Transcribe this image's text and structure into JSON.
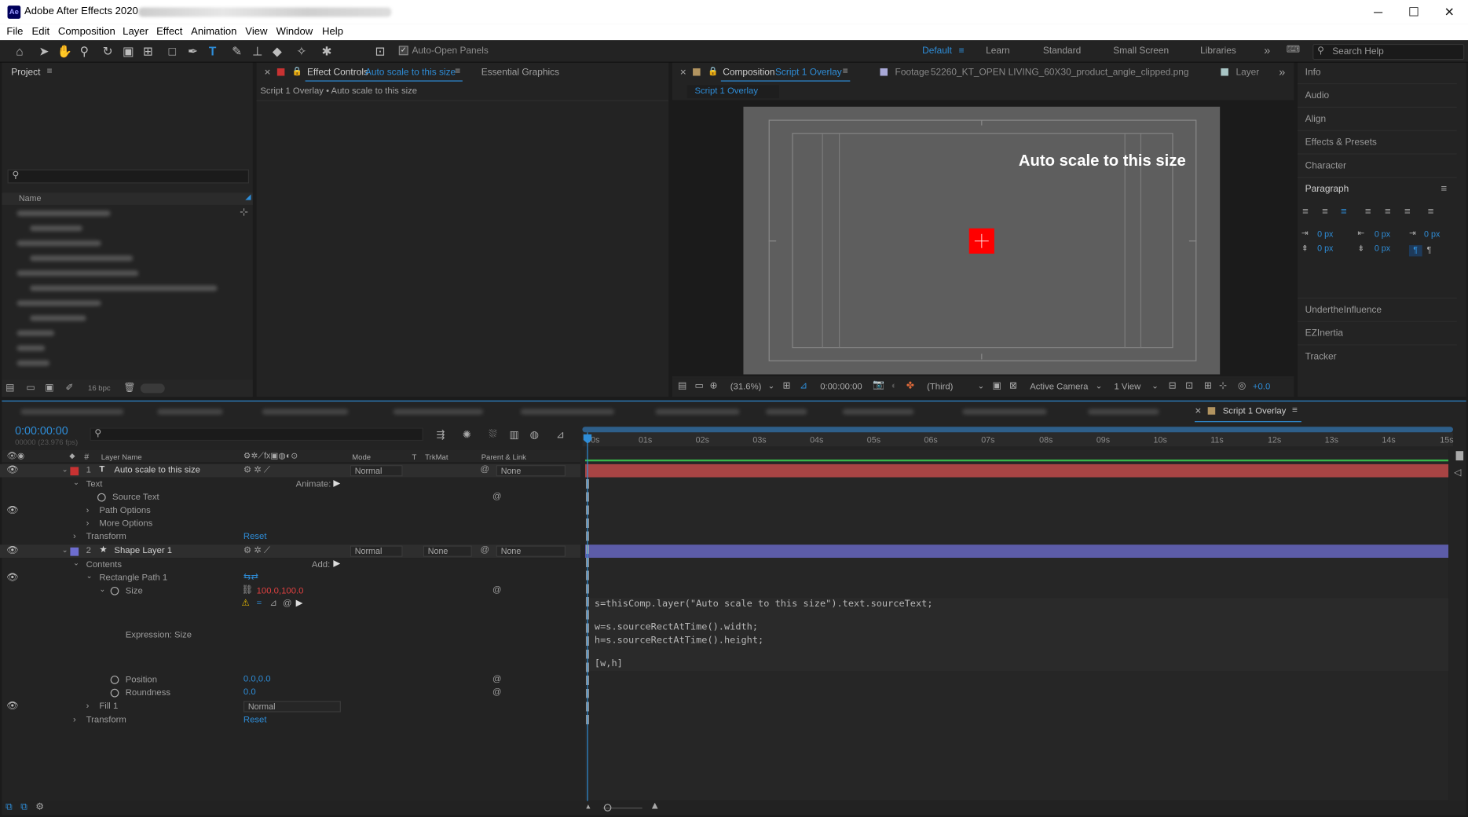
{
  "window": {
    "title": "Adobe After Effects 2020 -",
    "icon": "Ae",
    "controls": {
      "minimize": "─",
      "maximize": "☐",
      "close": "✕"
    }
  },
  "menu": [
    "File",
    "Edit",
    "Composition",
    "Layer",
    "Effect",
    "Animation",
    "View",
    "Window",
    "Help"
  ],
  "toolbar": {
    "auto_open_label": "Auto-Open Panels",
    "workspaces": [
      "Default",
      "Learn",
      "Standard",
      "Small Screen",
      "Libraries"
    ],
    "active_workspace": "Default",
    "search_placeholder": "Search Help",
    "expand": "»"
  },
  "project": {
    "title": "Project",
    "name_header": "Name",
    "bpc": "16 bpc"
  },
  "effect_controls": {
    "tab_label": "Effect Controls",
    "tab_target": "Auto scale to this size",
    "tab2": "Essential Graphics",
    "breadcrumb": "Script 1 Overlay • Auto scale to this size"
  },
  "composition": {
    "tab_label": "Composition",
    "tab_name": "Script 1 Overlay",
    "footage_label": "Footage",
    "footage_name": "52260_KT_OPEN LIVING_60X30_product_angle_clipped.png",
    "layer_tab": "Layer",
    "subtab": "Script 1 Overlay",
    "overlay_text": "Auto scale to this size",
    "zoom": "(31.6%)",
    "timecode": "0:00:00:00",
    "resolution": "(Third)",
    "camera": "Active Camera",
    "views": "1 View",
    "exposure": "+0.0",
    "accent": "#2e8dd8",
    "square_color": "#ff0000"
  },
  "right_panels": {
    "top": [
      "Info",
      "Audio",
      "Align",
      "Effects & Presets",
      "Character"
    ],
    "paragraph_title": "Paragraph",
    "px_values": [
      "0 px",
      "0 px",
      "0 px",
      "0 px",
      "0 px"
    ],
    "bottom": [
      "UndertheInfluence",
      "EZInertia",
      "Tracker"
    ]
  },
  "timeline": {
    "tab_label": "Script 1 Overlay",
    "current_time": "0:00:00:00",
    "fps_line": "00000 (23.976 fps)",
    "headers": {
      "layer_name": "Layer Name",
      "mode": "Mode",
      "t": "T",
      "trkmat": "TrkMat",
      "parent": "Parent & Link"
    },
    "ruler": [
      "00s",
      "01s",
      "02s",
      "03s",
      "04s",
      "05s",
      "06s",
      "07s",
      "08s",
      "09s",
      "10s",
      "11s",
      "12s",
      "13s",
      "14s",
      "15s"
    ]
  },
  "layers": {
    "l1_num": "1",
    "l1_name": "Auto scale to this size",
    "l1_mode": "Normal",
    "l1_parent": "None",
    "text_group": "Text",
    "animate": "Animate:",
    "source_text": "Source Text",
    "path_options": "Path Options",
    "more_options": "More Options",
    "transform1": "Transform",
    "reset1": "Reset",
    "l2_num": "2",
    "l2_name": "Shape Layer 1",
    "l2_mode": "Normal",
    "l2_trkmat": "None",
    "l2_parent": "None",
    "contents": "Contents",
    "add": "Add:",
    "rect_path": "Rectangle Path 1",
    "size": "Size",
    "size_value": "100.0,100.0",
    "expression_label": "Expression: Size",
    "position": "Position",
    "position_value": "0.0,0.0",
    "roundness": "Roundness",
    "roundness_value": "0.0",
    "fill": "Fill 1",
    "fill_mode": "Normal",
    "transform2": "Transform",
    "reset2": "Reset",
    "layer1_color": "#c83232",
    "layer2_color": "#6d6dcf"
  },
  "expression": [
    "s=thisComp.layer(\"Auto scale to this size\").text.sourceText;",
    "w=s.sourceRectAtTime().width;",
    "h=s.sourceRectAtTime().height;",
    "[w,h]"
  ]
}
